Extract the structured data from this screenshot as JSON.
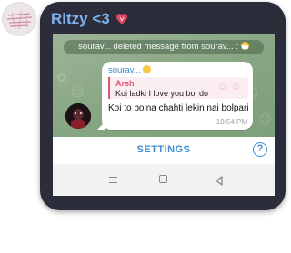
{
  "chat": {
    "title": "Ritzy <3",
    "service_message": "sourav... deleted message from sourav... :",
    "message": {
      "sender": "sourav...",
      "reply_to_name": "Arsh",
      "reply_to_text": "Koi ladki I love you bol do",
      "text": "Koi to bolna chahti lekin nai bolpari",
      "time": "10:54 PM"
    }
  },
  "bottom_bar": {
    "settings_label": "SETTINGS",
    "help_icon": "?"
  },
  "icons": {
    "heart": "heart-icon",
    "mask": "mask-emoji-icon",
    "smile": "smile-emoji-icon",
    "help": "question-icon",
    "nav_recents": "menu-icon",
    "nav_home": "home-square-icon",
    "nav_back": "back-triangle-icon"
  },
  "colors": {
    "title": "#7fb3f0",
    "phone_frame": "#2b2d3b",
    "chat_bg": "#8aa985",
    "sender": "#3d8fd1",
    "reply_accent": "#e25578",
    "settings": "#3c8fd6"
  }
}
